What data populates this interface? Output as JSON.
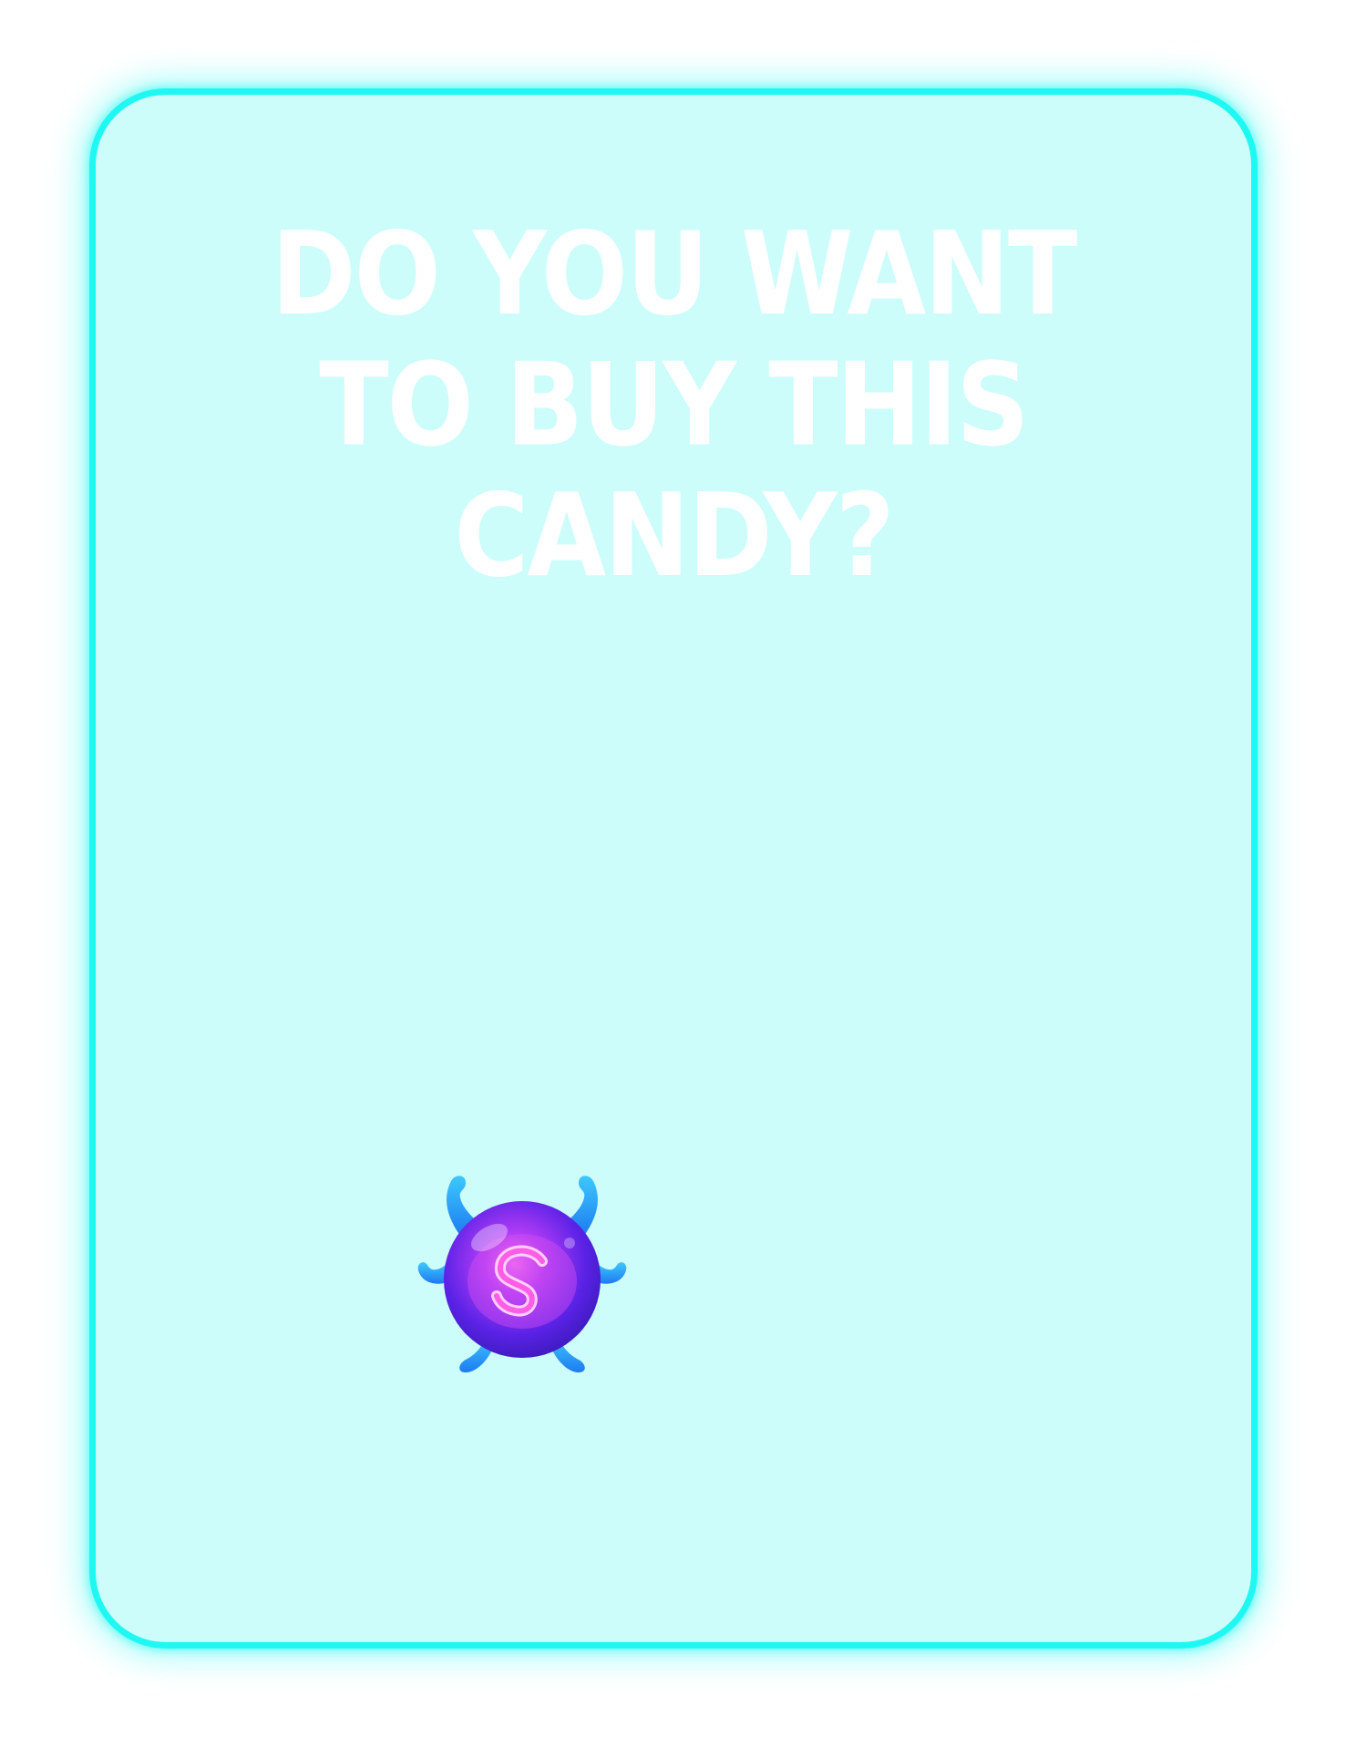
{
  "dialog": {
    "title": "Do you want to buy this candy?"
  },
  "candy": {
    "icon": "galaxy-jelly-candy-icon",
    "colors": {
      "body": "#7a2cf0",
      "swirl": "#ff5de6",
      "tentacles": "#2ea6ff"
    }
  },
  "theme": {
    "border": "#1ff8f2",
    "background": "#ccfdfa",
    "text": "#ffffff"
  }
}
